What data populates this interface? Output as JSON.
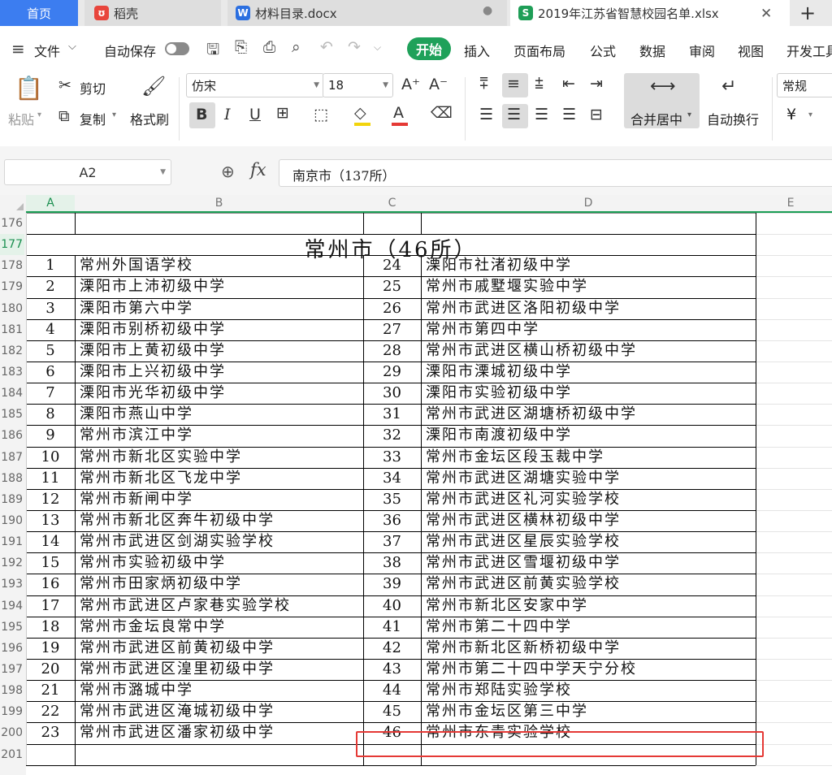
{
  "tabs": {
    "home": "首页",
    "daoke": "稻壳",
    "doc": "材料目录.docx",
    "xlsx": "2019年江苏省智慧校园名单.xlsx",
    "add": "+"
  },
  "menu": {
    "file": "文件",
    "autosave": "自动保存",
    "start": "开始",
    "insert": "插入",
    "page_layout": "页面布局",
    "formula": "公式",
    "data": "数据",
    "review": "审阅",
    "view": "视图",
    "developer": "开发工具"
  },
  "ribbon": {
    "paste": "粘贴",
    "cut": "剪切",
    "copy": "复制",
    "format_painter": "格式刷",
    "font_name": "仿宋",
    "font_size": "18",
    "merge_center": "合并居中",
    "wrap_text": "自动换行",
    "number_format": "常规",
    "currency_symbol": "¥"
  },
  "formula_bar": {
    "cell_ref": "A2",
    "fx": "fx",
    "content": "南京市（137所）"
  },
  "columns": [
    "A",
    "B",
    "C",
    "D",
    "E"
  ],
  "rows": [
    "176",
    "177",
    "178",
    "179",
    "180",
    "181",
    "182",
    "183",
    "184",
    "185",
    "186",
    "187",
    "188",
    "189",
    "190",
    "191",
    "192",
    "193",
    "194",
    "195",
    "196",
    "197",
    "198",
    "199",
    "200",
    "201"
  ],
  "sheet": {
    "title": "常州市（46所）",
    "left": [
      {
        "no": "1",
        "name": "常州外国语学校"
      },
      {
        "no": "2",
        "name": "溧阳市上沛初级中学"
      },
      {
        "no": "3",
        "name": "溧阳市第六中学"
      },
      {
        "no": "4",
        "name": "溧阳市别桥初级中学"
      },
      {
        "no": "5",
        "name": "溧阳市上黄初级中学"
      },
      {
        "no": "6",
        "name": "溧阳市上兴初级中学"
      },
      {
        "no": "7",
        "name": "溧阳市光华初级中学"
      },
      {
        "no": "8",
        "name": "溧阳市燕山中学"
      },
      {
        "no": "9",
        "name": "常州市滨江中学"
      },
      {
        "no": "10",
        "name": "常州市新北区实验中学"
      },
      {
        "no": "11",
        "name": "常州市新北区飞龙中学"
      },
      {
        "no": "12",
        "name": "常州市新闸中学"
      },
      {
        "no": "13",
        "name": "常州市新北区奔牛初级中学"
      },
      {
        "no": "14",
        "name": "常州市武进区剑湖实验学校"
      },
      {
        "no": "15",
        "name": "常州市实验初级中学"
      },
      {
        "no": "16",
        "name": "常州市田家炳初级中学"
      },
      {
        "no": "17",
        "name": "常州市武进区卢家巷实验学校"
      },
      {
        "no": "18",
        "name": "常州市金坛良常中学"
      },
      {
        "no": "19",
        "name": "常州市武进区前黄初级中学"
      },
      {
        "no": "20",
        "name": "常州市武进区湟里初级中学"
      },
      {
        "no": "21",
        "name": "常州市潞城中学"
      },
      {
        "no": "22",
        "name": "常州市武进区淹城初级中学"
      },
      {
        "no": "23",
        "name": "常州市武进区潘家初级中学"
      }
    ],
    "right": [
      {
        "no": "24",
        "name": "溧阳市社渚初级中学"
      },
      {
        "no": "25",
        "name": "常州市戚墅堰实验中学"
      },
      {
        "no": "26",
        "name": "常州市武进区洛阳初级中学"
      },
      {
        "no": "27",
        "name": "常州市第四中学"
      },
      {
        "no": "28",
        "name": "常州市武进区横山桥初级中学"
      },
      {
        "no": "29",
        "name": "溧阳市溧城初级中学"
      },
      {
        "no": "30",
        "name": "溧阳市实验初级中学"
      },
      {
        "no": "31",
        "name": "常州市武进区湖塘桥初级中学"
      },
      {
        "no": "32",
        "name": "溧阳市南渡初级中学"
      },
      {
        "no": "33",
        "name": "常州市金坛区段玉裁中学"
      },
      {
        "no": "34",
        "name": "常州市武进区湖塘实验中学"
      },
      {
        "no": "35",
        "name": "常州市武进区礼河实验学校"
      },
      {
        "no": "36",
        "name": "常州市武进区横林初级中学"
      },
      {
        "no": "37",
        "name": "常州市武进区星辰实验学校"
      },
      {
        "no": "38",
        "name": "常州市武进区雪堰初级中学"
      },
      {
        "no": "39",
        "name": "常州市武进区前黄实验学校"
      },
      {
        "no": "40",
        "name": "常州市新北区安家中学"
      },
      {
        "no": "41",
        "name": "常州市第二十四中学"
      },
      {
        "no": "42",
        "name": "常州市新北区新桥初级中学"
      },
      {
        "no": "43",
        "name": "常州市第二十四中学天宁分校"
      },
      {
        "no": "44",
        "name": "常州市郑陆实验学校"
      },
      {
        "no": "45",
        "name": "常州市金坛区第三中学"
      },
      {
        "no": "46",
        "name": "常州市东青实验学校"
      }
    ]
  },
  "colors": {
    "accent_green": "#1fa15a",
    "tab_blue": "#3c7df0",
    "highlight_red": "#e53935"
  }
}
